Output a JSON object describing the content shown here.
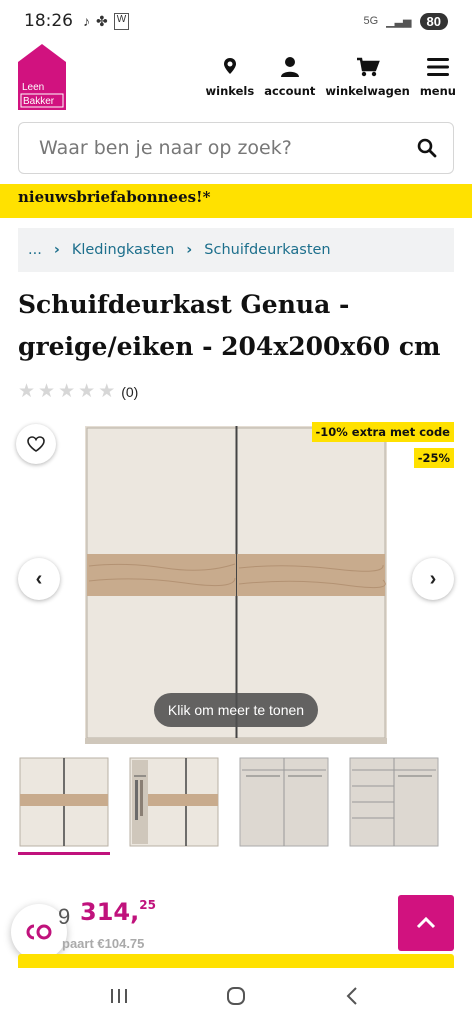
{
  "status_bar": {
    "time": "18:26",
    "network": "5G",
    "battery": "80"
  },
  "header": {
    "logo_line1": "Leen",
    "logo_line2": "Bakker",
    "nav": [
      {
        "label": "winkels",
        "icon": "location-pin-icon"
      },
      {
        "label": "account",
        "icon": "user-icon"
      },
      {
        "label": "winkelwagen",
        "icon": "cart-icon"
      },
      {
        "label": "menu",
        "icon": "hamburger-menu-icon"
      }
    ]
  },
  "search": {
    "placeholder": "Waar ben je naar op zoek?"
  },
  "banner": {
    "text": "nieuwsbriefabonnees!*"
  },
  "breadcrumb": {
    "items": [
      "...",
      "Kledingkasten",
      "Schuifdeurkasten"
    ]
  },
  "product": {
    "title": "Schuifdeurkast Genua - greige/eiken - 204x200x60 cm",
    "review_count": "(0)",
    "rating": 0
  },
  "gallery": {
    "badge_extra": "-10% extra met code",
    "badge_discount": "-25%",
    "tooltip": "Klik om meer te tonen"
  },
  "price": {
    "old_fragment": "9",
    "current": "314,",
    "current_cents": "25",
    "savings": "paart €104.75"
  },
  "colors": {
    "brand": "#d1127f",
    "accent": "#ffe100",
    "link": "#1d6f8c"
  }
}
